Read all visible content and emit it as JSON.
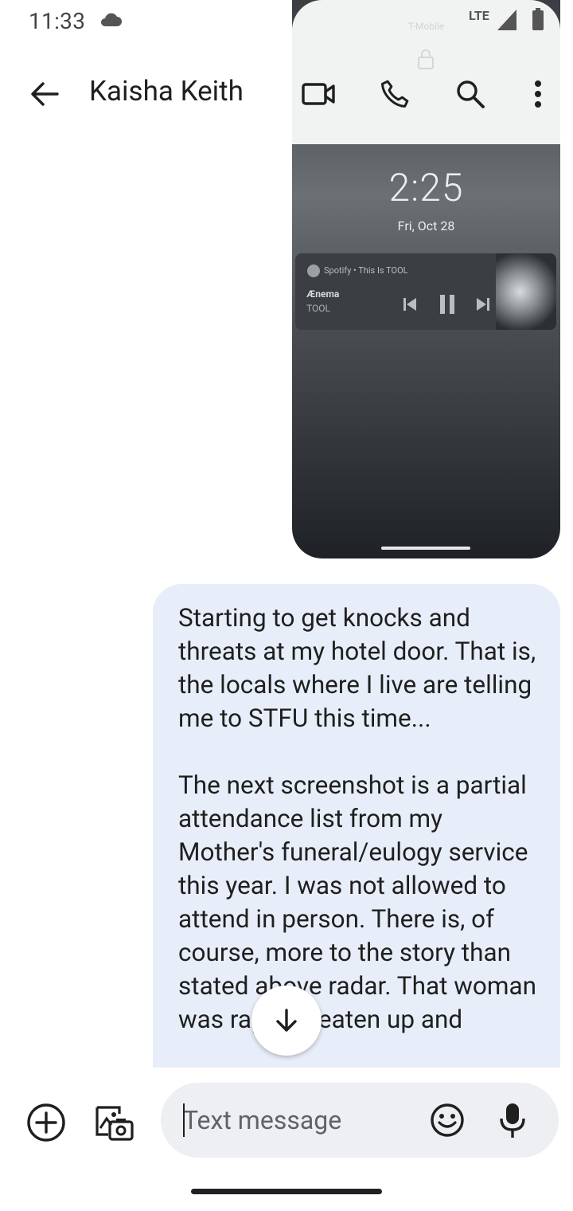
{
  "status_bar": {
    "time": "11:33"
  },
  "header": {
    "contact_name": "Kaisha Keith",
    "icons": [
      "back-arrow-icon",
      "video-call-icon",
      "phone-icon",
      "search-icon",
      "more-vert-icon"
    ]
  },
  "attachment": {
    "carrier": "T-Mobile",
    "network": "LTE",
    "battery": "72",
    "clock": "2:25",
    "date": "Fri, Oct 28",
    "media": {
      "source": "Spotify • This Is TOOL",
      "track": "Ænema",
      "artist": "TOOL"
    }
  },
  "message": {
    "text": "Starting to get knocks and threats at my hotel door. That is, the locals where I live are telling me to STFU this time...\n\nThe next screenshot is a partial attendance list from my Mother's funeral/eulogy service this year. I was not allowed to attend in person. There is, of course, more to the story than stated above radar. That woman was raped, beaten up and"
  },
  "composer": {
    "placeholder": "Text message"
  },
  "colors": {
    "bubble": "#e8eef9",
    "composer_field": "#edeff2"
  }
}
